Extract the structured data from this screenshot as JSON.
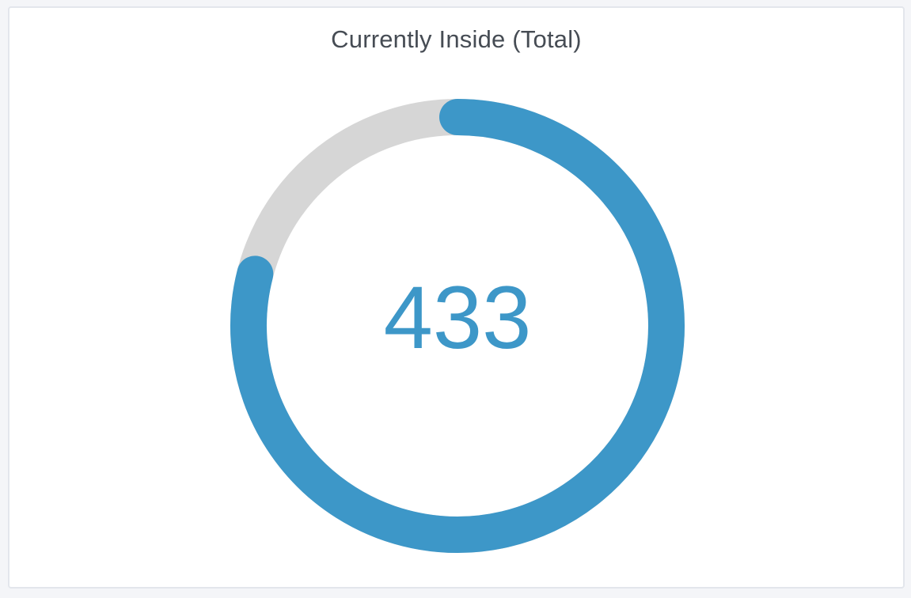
{
  "panel": {
    "title": "Currently Inside (Total)"
  },
  "gauge": {
    "value": "433",
    "fill_fraction": 0.79,
    "colors": {
      "fill": "#3d97c8",
      "track": "#d6d6d6",
      "value_text": "#3d97c8"
    }
  }
}
